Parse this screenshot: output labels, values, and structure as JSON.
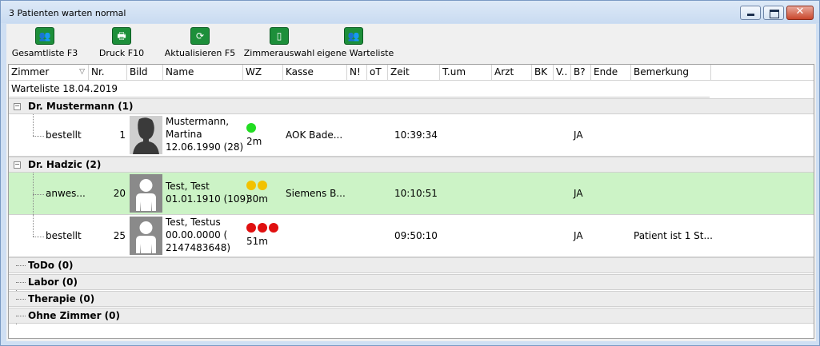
{
  "window": {
    "title": "3 Patienten warten normal",
    "close_glyph": "✕"
  },
  "toolbar": [
    {
      "label": "Gesamtliste F3",
      "icon": "people-icon",
      "glyph": "👥"
    },
    {
      "label": "Druck F10",
      "icon": "printer-icon",
      "glyph": "🖶"
    },
    {
      "label": "Aktualisieren F5",
      "icon": "refresh-icon",
      "glyph": "⟳"
    },
    {
      "label": "Zimmerauswahl",
      "icon": "door-icon",
      "glyph": "▯"
    },
    {
      "label": "eigene Warteliste",
      "icon": "person-list-icon",
      "glyph": "👥"
    }
  ],
  "columns": [
    "Zimmer",
    "Nr.",
    "Bild",
    "Name",
    "WZ",
    "Kasse",
    "N!",
    "oT",
    "Zeit",
    "T.um",
    "Arzt",
    "BK",
    "V..",
    "B?",
    "Ende",
    "Bemerkung"
  ],
  "sort_arrow": "▽",
  "waitlist_date": "Warteliste 18.04.2019",
  "groups": [
    {
      "label": "Dr. Mustermann (1)",
      "toggle": "−"
    },
    {
      "label": "Dr. Hadzic (2)",
      "toggle": "−"
    },
    {
      "label": "ToDo (0)"
    },
    {
      "label": "Labor (0)"
    },
    {
      "label": "Therapie (0)"
    },
    {
      "label": "Ohne Zimmer (0)"
    }
  ],
  "patients": [
    {
      "status": "bestellt",
      "nr": "1",
      "name_line1": "Mustermann,",
      "name_line2": "Martina",
      "name_line3": "12.06.1990 (28)",
      "wait_time": "2m",
      "dots": [
        "#22dd22"
      ],
      "kasse": "AOK Bade...",
      "zeit": "10:39:34",
      "b": "JA",
      "bemerkung": "",
      "highlight": false
    },
    {
      "status": "anwes...",
      "nr": "20",
      "name_line1": "Test, Test",
      "name_line2": "01.01.1910 (109)",
      "name_line3": "",
      "wait_time": "30m",
      "dots": [
        "#f2c200",
        "#f2c200"
      ],
      "kasse": "Siemens B...",
      "zeit": "10:10:51",
      "b": "JA",
      "bemerkung": "",
      "highlight": true
    },
    {
      "status": "bestellt",
      "nr": "25",
      "name_line1": "Test, Testus",
      "name_line2": "00.00.0000 (",
      "name_line3": "2147483648)",
      "wait_time": "51m",
      "dots": [
        "#e01010",
        "#e01010",
        "#e01010"
      ],
      "kasse": "",
      "zeit": "09:50:10",
      "b": "JA",
      "bemerkung": "Patient ist 1 St...",
      "highlight": false
    }
  ],
  "colors": {
    "highlight_row": "#ccf3c6",
    "toolbar_icon": "#1d8f3a"
  }
}
